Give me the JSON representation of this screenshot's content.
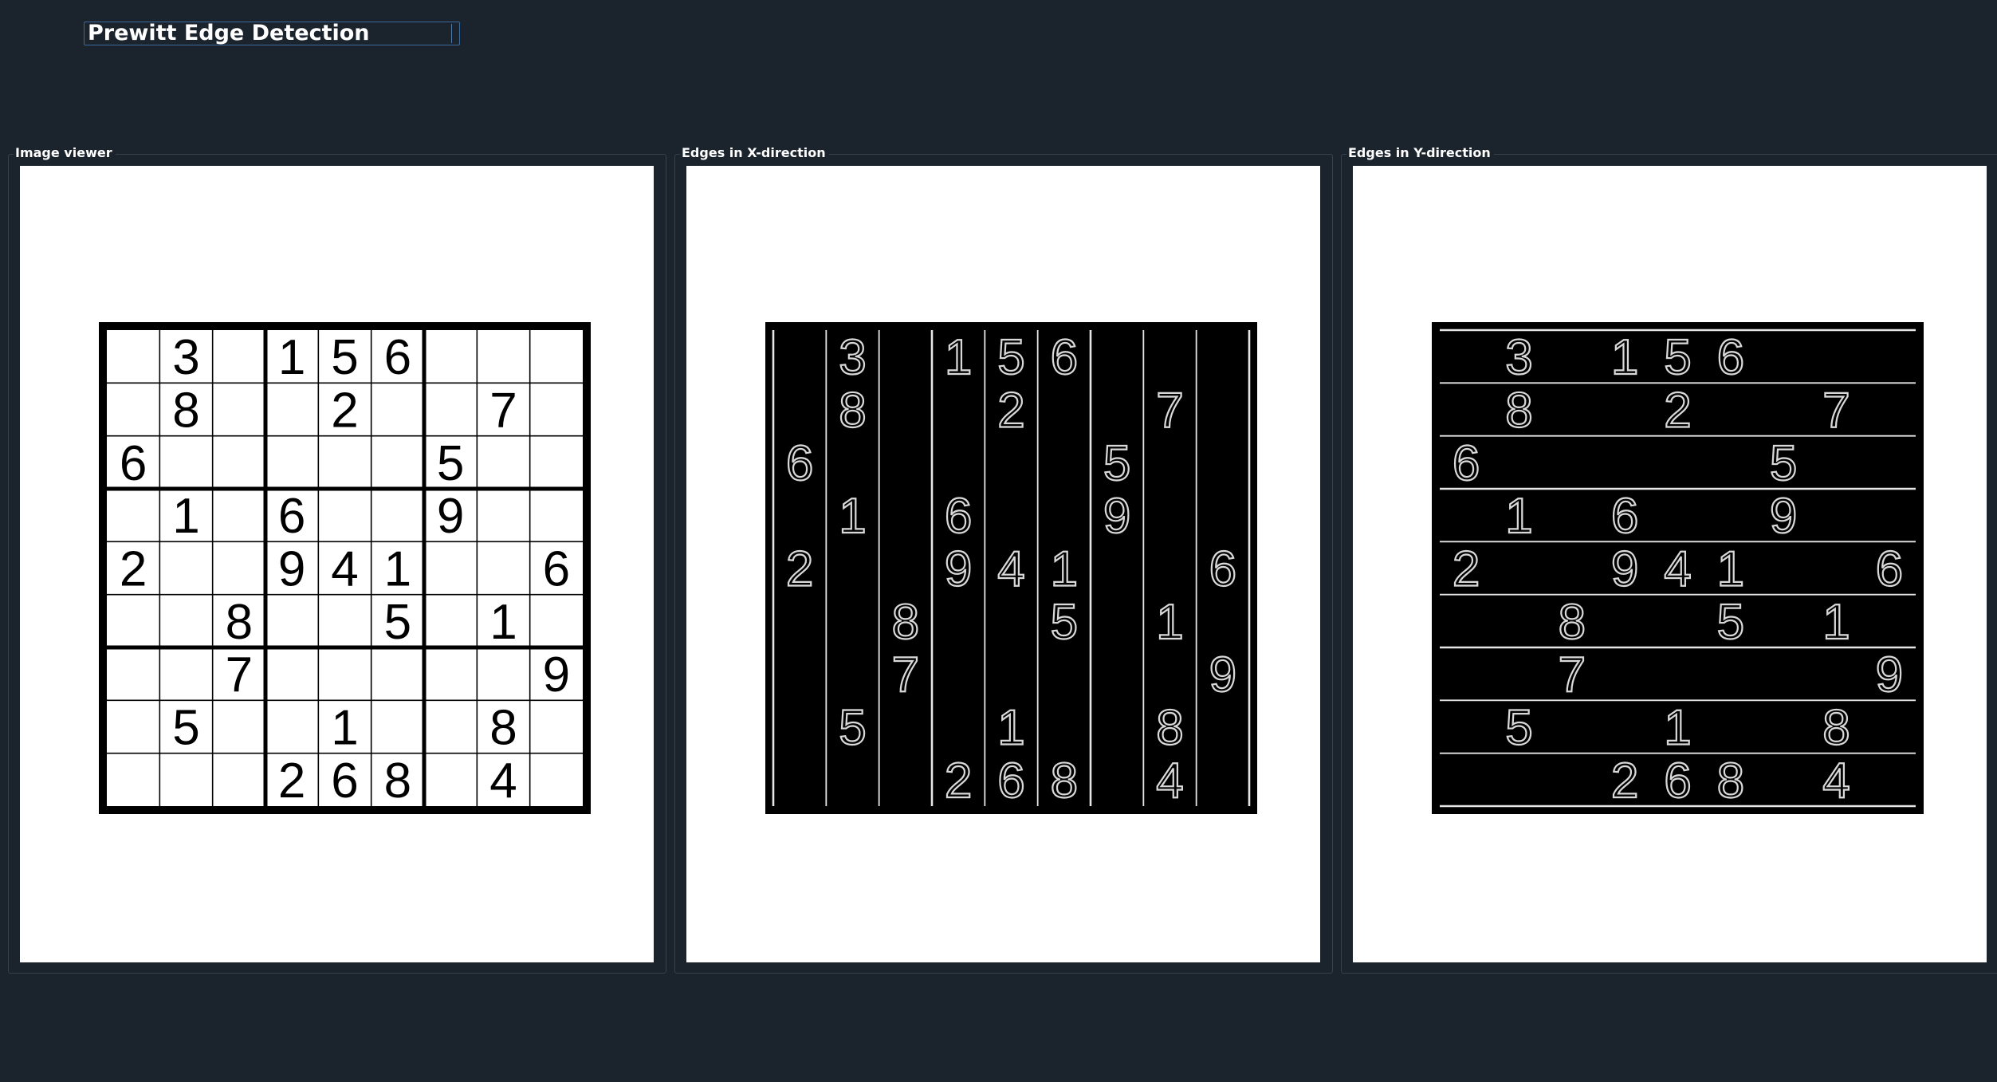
{
  "window": {
    "title": "Prewitt Edge Detection"
  },
  "panels": [
    {
      "id": "original",
      "label": "Image viewer",
      "mode": "original"
    },
    {
      "id": "edges-x",
      "label": "Edges in X-direction",
      "mode": "x"
    },
    {
      "id": "edges-y",
      "label": "Edges in Y-direction",
      "mode": "y"
    }
  ],
  "sudoku": {
    "grid": [
      [
        "",
        "3",
        "",
        "1",
        "5",
        "6",
        "",
        "",
        ""
      ],
      [
        "",
        "8",
        "",
        "",
        "2",
        "",
        "",
        "7",
        ""
      ],
      [
        "6",
        "",
        "",
        "",
        "",
        "",
        "5",
        "",
        ""
      ],
      [
        "",
        "1",
        "",
        "6",
        "",
        "",
        "9",
        "",
        ""
      ],
      [
        "2",
        "",
        "",
        "9",
        "4",
        "1",
        "",
        "",
        "6"
      ],
      [
        "",
        "",
        "8",
        "",
        "",
        "5",
        "",
        "1",
        ""
      ],
      [
        "",
        "",
        "7",
        "",
        "",
        "",
        "",
        "",
        "9"
      ],
      [
        "",
        "5",
        "",
        "",
        "1",
        "",
        "",
        "8",
        ""
      ],
      [
        "",
        "",
        "",
        "2",
        "6",
        "8",
        "",
        "4",
        ""
      ]
    ]
  },
  "colors": {
    "background": "#1b232d",
    "title_border": "#3c6a9c",
    "panel_border": "#36414e",
    "canvas": "#ffffff",
    "ink": "#000000",
    "edge": "#ffffff"
  }
}
